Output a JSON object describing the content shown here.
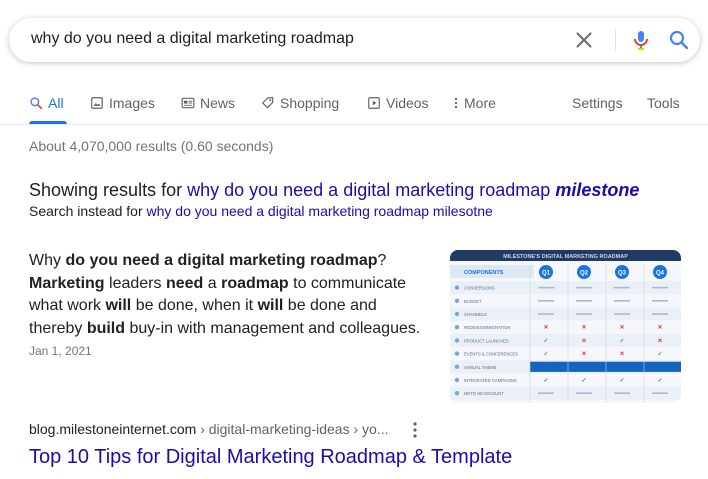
{
  "search": {
    "query": "why do you need a digital marketing roadmap"
  },
  "tabs": [
    {
      "label": "All",
      "icon": "search-icon",
      "active": true
    },
    {
      "label": "Images",
      "icon": "image-icon"
    },
    {
      "label": "News",
      "icon": "news-icon"
    },
    {
      "label": "Shopping",
      "icon": "tag-icon"
    },
    {
      "label": "Videos",
      "icon": "play-icon"
    },
    {
      "label": "More",
      "icon": "vertical-dots-icon"
    },
    {
      "label": "Settings"
    },
    {
      "label": "Tools"
    }
  ],
  "stats": "About 4,070,000 results (0.60 seconds)",
  "spelling": {
    "showing_prefix": "Showing results for ",
    "corrected_query": "why do you need a digital marketing roadmap",
    "corrected_term": "milestone",
    "instead_prefix": "Search instead for ",
    "original_query": "why do you need a digital marketing roadmap milesotne"
  },
  "snippet": {
    "parts": [
      {
        "t": "Why ",
        "b": false
      },
      {
        "t": "do you need a digital marketing roadmap",
        "b": true
      },
      {
        "t": "? ",
        "b": false
      },
      {
        "t": "Marketing",
        "b": true
      },
      {
        "t": " leaders ",
        "b": false
      },
      {
        "t": "need",
        "b": true
      },
      {
        "t": " a ",
        "b": false
      },
      {
        "t": "roadmap",
        "b": true
      },
      {
        "t": " to communicate what work ",
        "b": false
      },
      {
        "t": "will",
        "b": true
      },
      {
        "t": " be done, when it ",
        "b": false
      },
      {
        "t": "will",
        "b": true
      },
      {
        "t": " be done and thereby ",
        "b": false
      },
      {
        "t": "build",
        "b": true
      },
      {
        "t": " buy-in with management and colleagues.",
        "b": false
      }
    ],
    "date": "Jan 1, 2021"
  },
  "thumbnail": {
    "header": "MILESTONE'S DIGITAL MARKETING ROADMAP",
    "components_label": "COMPONENTS",
    "quarters": [
      "Q1",
      "Q2",
      "Q3",
      "Q4"
    ],
    "rows": [
      "CONVERSIONS",
      "BUDGET",
      "CHANNELS",
      "REDESIGN/MIGRATION",
      "PRODUCT LAUNCHES",
      "EVENTS & CONFERENCES",
      "ANNUAL THEME",
      "INTEGRATED CAMPAIGNS",
      "MKTG HEADCOUNT"
    ],
    "colors": {
      "header": "#1f3b63",
      "quarter": "#1a73e8",
      "theme": "#1565c0"
    }
  },
  "result": {
    "cite_domain": "blog.milestoneinternet.com",
    "cite_path": " › digital-marketing-ideas › yo...",
    "title": "Top 10 Tips for Digital Marketing Roadmap & Template"
  },
  "colors": {
    "link": "#1a0dab",
    "accent": "#1a73e8",
    "muted": "#70757a"
  }
}
